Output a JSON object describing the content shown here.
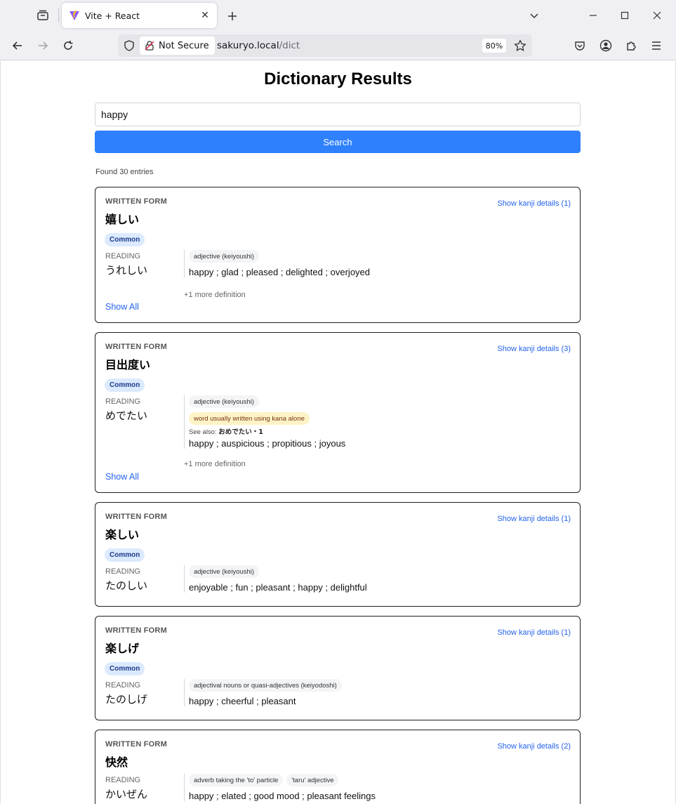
{
  "browser": {
    "tab_title": "Vite + React",
    "security_text": "Not Secure",
    "url_host": "sakuryo.local",
    "url_path": "/dict",
    "zoom": "80%"
  },
  "page": {
    "title": "Dictionary Results",
    "search_value": "happy",
    "search_button": "Search",
    "found_text": "Found 30 entries",
    "written_form_label": "WRITTEN FORM",
    "reading_label": "READING",
    "common_label": "Common",
    "show_all_label": "Show All",
    "see_also_prefix": "See also:"
  },
  "entries": [
    {
      "word": "嬉しい",
      "kanji_link": "Show kanji details (1)",
      "reading": "うれしい",
      "pos": [
        "adjective (keiyoushi)"
      ],
      "gloss": "happy ; glad ; pleased ; delighted ; overjoyed",
      "more": "+1 more definition"
    },
    {
      "word": "目出度い",
      "kanji_link": "Show kanji details (3)",
      "reading": "めでたい",
      "pos": [
        "adjective (keiyoushi)"
      ],
      "misc": "word usually written using kana alone",
      "see_also": "おめでたい・1",
      "gloss": "happy ; auspicious ; propitious ; joyous",
      "more": "+1 more definition"
    },
    {
      "word": "楽しい",
      "kanji_link": "Show kanji details (1)",
      "reading": "たのしい",
      "pos": [
        "adjective (keiyoushi)"
      ],
      "gloss": "enjoyable ; fun ; pleasant ; happy ; delightful"
    },
    {
      "word": "楽しげ",
      "kanji_link": "Show kanji details (1)",
      "reading": "たのしげ",
      "pos": [
        "adjectival nouns or quasi-adjectives (keiyodoshi)"
      ],
      "gloss": "happy ; cheerful ; pleasant"
    },
    {
      "word": "快然",
      "kanji_link": "Show kanji details (2)",
      "reading": "かいぜん",
      "pos": [
        "adverb taking the 'to' particle",
        "'taru' adjective"
      ],
      "gloss": "happy ; elated ; good mood ; pleasant feelings"
    }
  ]
}
